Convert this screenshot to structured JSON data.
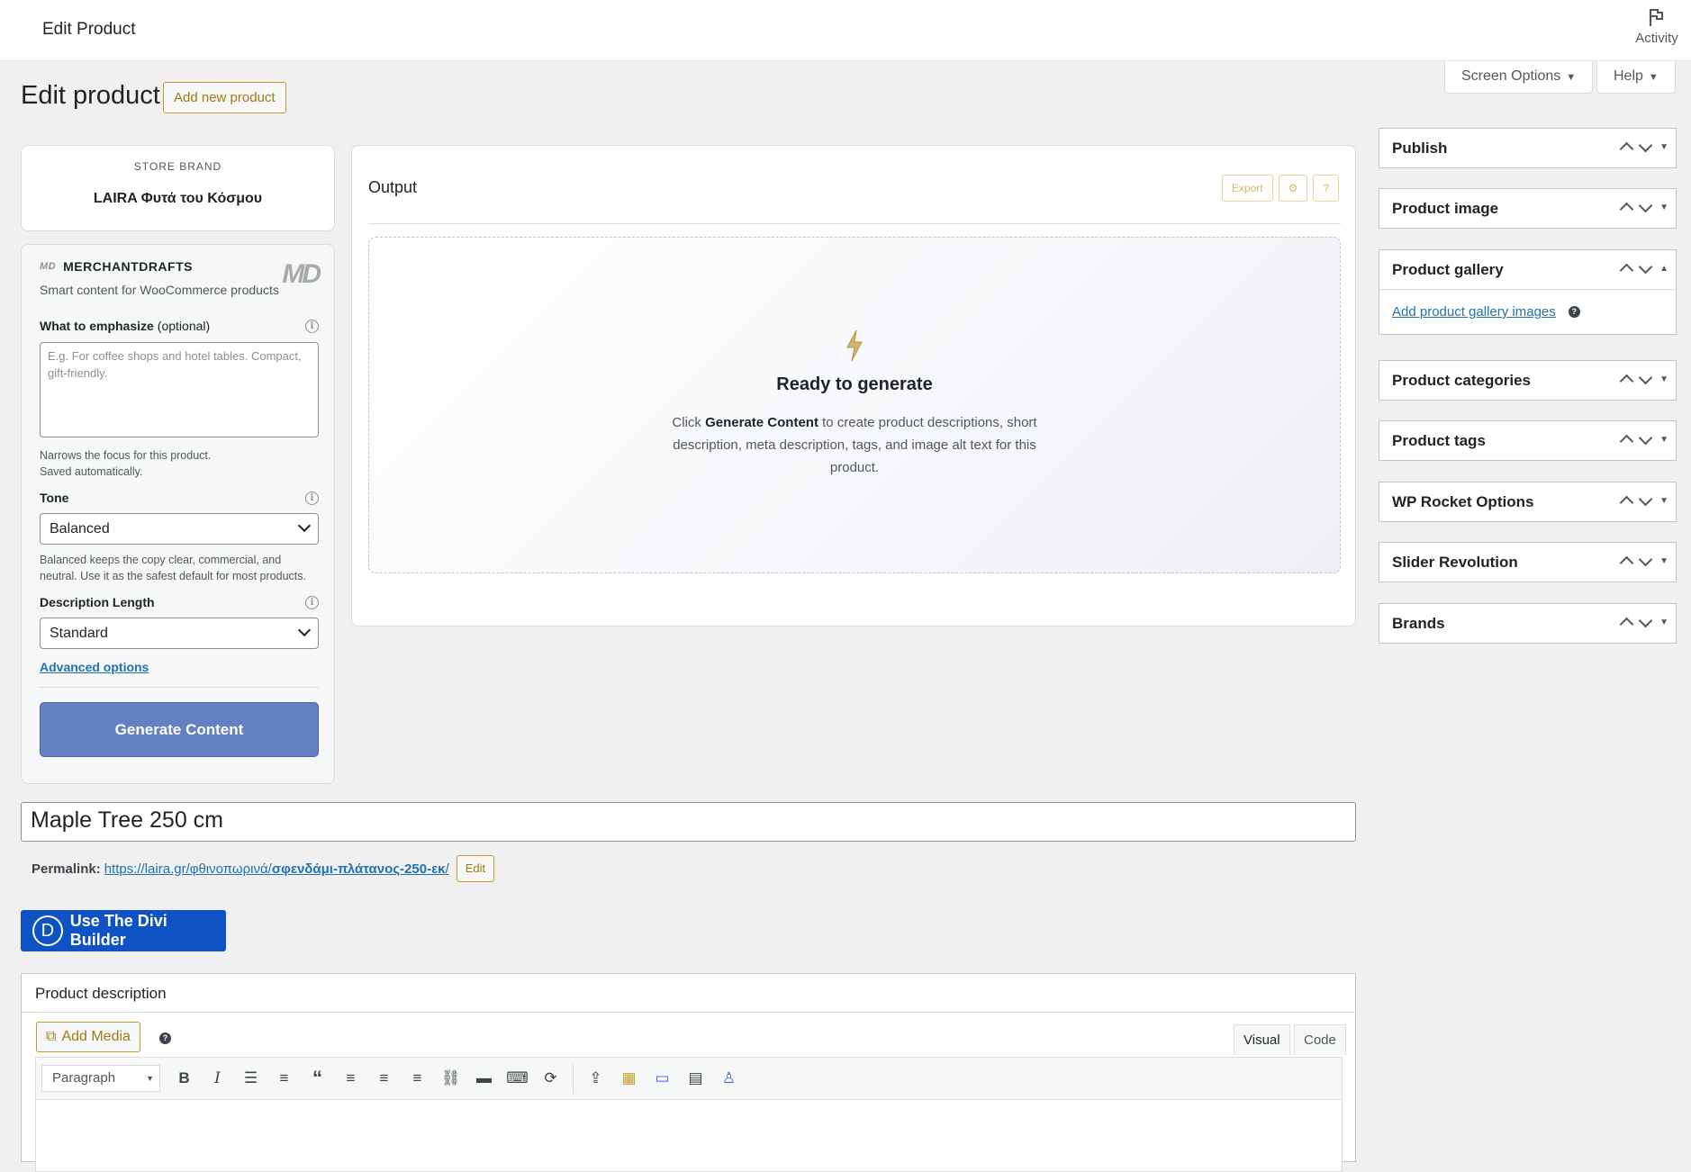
{
  "topbar": {
    "title": "Edit Product",
    "activity_label": "Activity"
  },
  "screen_options": {
    "label": "Screen Options",
    "help_label": "Help"
  },
  "page": {
    "title": "Edit product",
    "add_new_label": "Add new product"
  },
  "store_brand": {
    "label": "STORE BRAND",
    "name": "LAIRA Φυτά του Κόσμου"
  },
  "merchantdrafts": {
    "mini_logo": "MD",
    "name": "MERCHANTDRAFTS",
    "logo": "MD",
    "subtitle": "Smart content for WooCommerce products",
    "emphasize": {
      "label": "What to emphasize",
      "optional": "(optional)",
      "placeholder": "E.g. For coffee shops and hotel tables. Compact, gift-friendly.",
      "help_line1": "Narrows the focus for this product.",
      "help_line2": "Saved automatically."
    },
    "tone": {
      "label": "Tone",
      "value": "Balanced",
      "help": "Balanced keeps the copy clear, commercial, and neutral. Use it as the safest default for most products."
    },
    "length": {
      "label": "Description Length",
      "value": "Standard"
    },
    "advanced_label": "Advanced options",
    "generate_label": "Generate Content"
  },
  "output": {
    "title": "Output",
    "export_label": "Export",
    "settings_icon": "gear-icon",
    "help_label": "?",
    "bolt_icon": "lightning-bolt-icon",
    "ready_title": "Ready to generate",
    "desc_before": "Click ",
    "desc_bold": "Generate Content",
    "desc_after": " to create product descriptions, short description, meta description, tags, and image alt text for this product."
  },
  "product": {
    "title": "Maple Tree 250 cm",
    "permalink_label": "Permalink:",
    "permalink_base": "https://laira.gr/φθινοπωρινά/",
    "permalink_slug": "σφενδάμι-πλάτανος-250-εκ",
    "permalink_end": "/",
    "edit_label": "Edit"
  },
  "divi": {
    "icon_letter": "D",
    "label": "Use The Divi Builder"
  },
  "description_box": {
    "title": "Product description",
    "add_media_label": "Add Media",
    "visual_tab": "Visual",
    "code_tab": "Code",
    "format_value": "Paragraph"
  },
  "sidebar": {
    "boxes": [
      {
        "title": "Publish"
      },
      {
        "title": "Product image"
      },
      {
        "title": "Product gallery",
        "link": "Add product gallery images"
      },
      {
        "title": "Product categories"
      },
      {
        "title": "Product tags"
      },
      {
        "title": "WP Rocket Options"
      },
      {
        "title": "Slider Revolution"
      },
      {
        "title": "Brands"
      }
    ]
  },
  "colors": {
    "accent": "#c29a2c",
    "primary_button": "#6280c2",
    "divi": "#0e52c6",
    "link": "#2271b1"
  }
}
